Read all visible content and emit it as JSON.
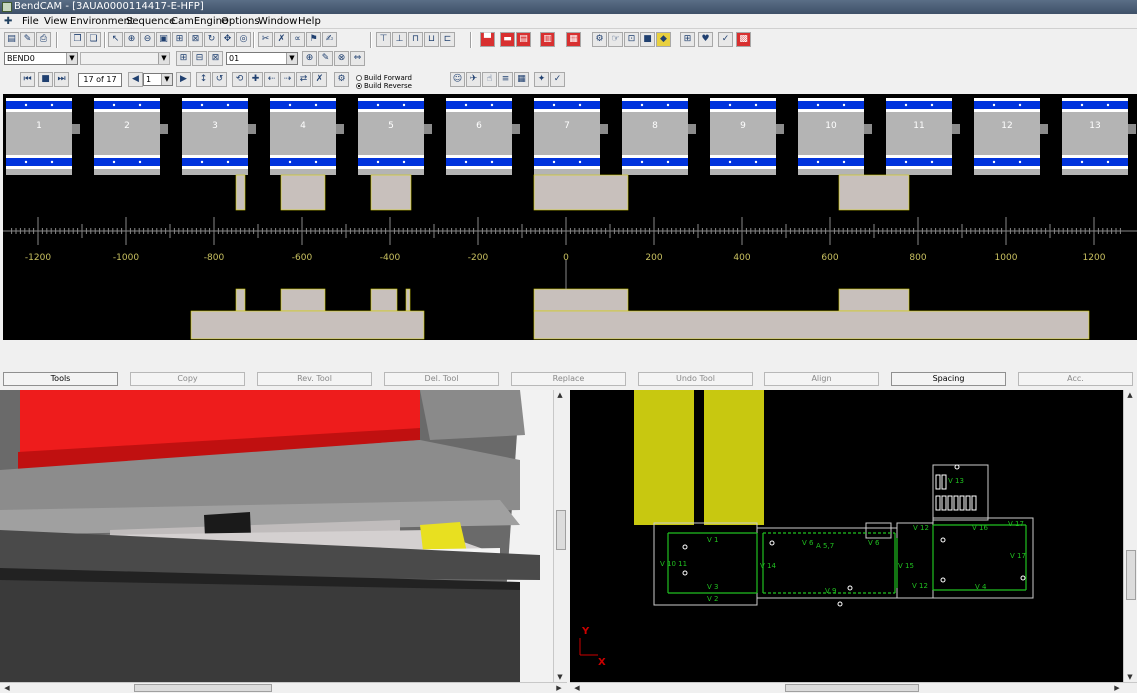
{
  "window": {
    "title": "BendCAM - [3AUA0000114417-E-HFP]"
  },
  "menu": [
    "File",
    "View",
    "Environment",
    "Sequence",
    "CamEngine",
    "Options",
    "Window",
    "Help"
  ],
  "toolbar2": {
    "bend_combo": "BEND0",
    "tool_combo": "01"
  },
  "toolbar3": {
    "page_counter": "17 of 17",
    "step_value": "1",
    "build_forward": "Build Forward",
    "build_reverse": "Build Reverse"
  },
  "bend_view": {
    "stations": [
      "1",
      "2",
      "3",
      "4",
      "5",
      "6",
      "7",
      "8",
      "9",
      "10",
      "11",
      "12",
      "13"
    ],
    "ruler_labels": [
      "-1200",
      "-1000",
      "-800",
      "-600",
      "-400",
      "-200",
      "0",
      "200",
      "400",
      "600",
      "800",
      "1000",
      "1200"
    ]
  },
  "buttons": [
    {
      "label": "Tools",
      "enabled": true
    },
    {
      "label": "Copy",
      "enabled": false
    },
    {
      "label": "Rev. Tool",
      "enabled": false
    },
    {
      "label": "Del. Tool",
      "enabled": false
    },
    {
      "label": "Replace",
      "enabled": false
    },
    {
      "label": "Undo Tool",
      "enabled": false
    },
    {
      "label": "Align",
      "enabled": false
    },
    {
      "label": "Spacing",
      "enabled": true
    },
    {
      "label": "Acc.",
      "enabled": false
    }
  ],
  "part_view": {
    "axis_y": "Y",
    "axis_x": "X",
    "labels": [
      "V 1",
      "V 3",
      "V 2",
      "V 10 11",
      "V 6",
      "A 5,7",
      "V 6",
      "V 9",
      "V 14",
      "V 15",
      "V 12",
      "V 16",
      "V 17",
      "V 17",
      "V 13",
      "V 4",
      "V 12"
    ]
  },
  "colors": {
    "accent_blue": "#0033dd",
    "tool_gray": "#b4b4b4",
    "die_beige": "#c8c0bc",
    "part_green": "#20c020",
    "punch_yellow": "#c8c810",
    "ram_red": "#ee1c1c"
  }
}
